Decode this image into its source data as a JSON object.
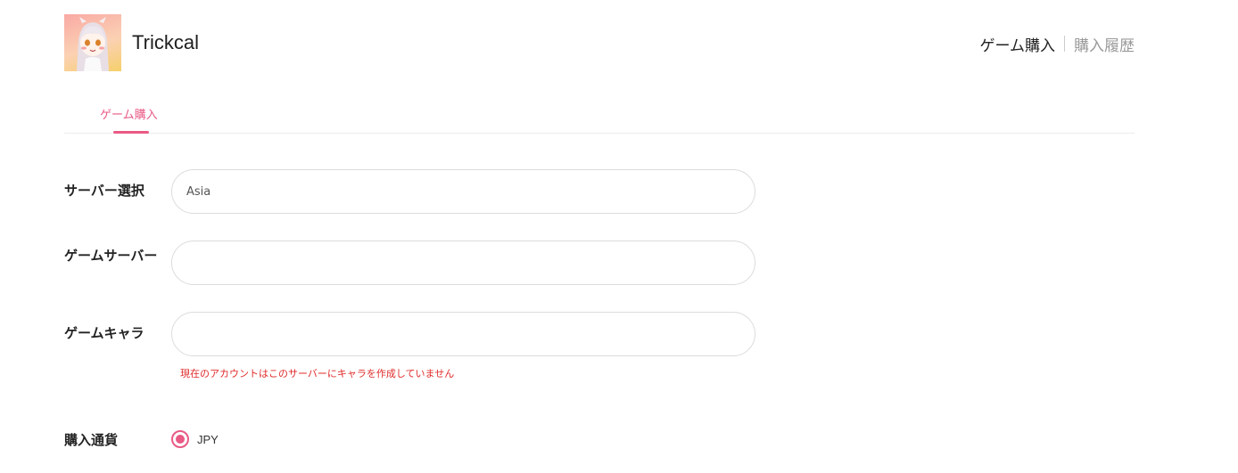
{
  "header": {
    "app_title": "Trickcal",
    "nav_purchase": "ゲーム購入",
    "nav_history": "購入履歴",
    "accent_color": "#e95a85"
  },
  "tabs": [
    {
      "label": "ゲーム購入",
      "active": true
    }
  ],
  "form": {
    "server_select": {
      "label": "サーバー選択",
      "value": "Asia"
    },
    "game_server": {
      "label": "ゲームサーバー",
      "value": ""
    },
    "game_character": {
      "label": "ゲームキャラ",
      "value": "",
      "error": "現在のアカウントはこのサーバーにキャラを作成していません"
    },
    "currency": {
      "label": "購入通貨",
      "options": [
        "JPY"
      ],
      "selected": "JPY"
    }
  }
}
